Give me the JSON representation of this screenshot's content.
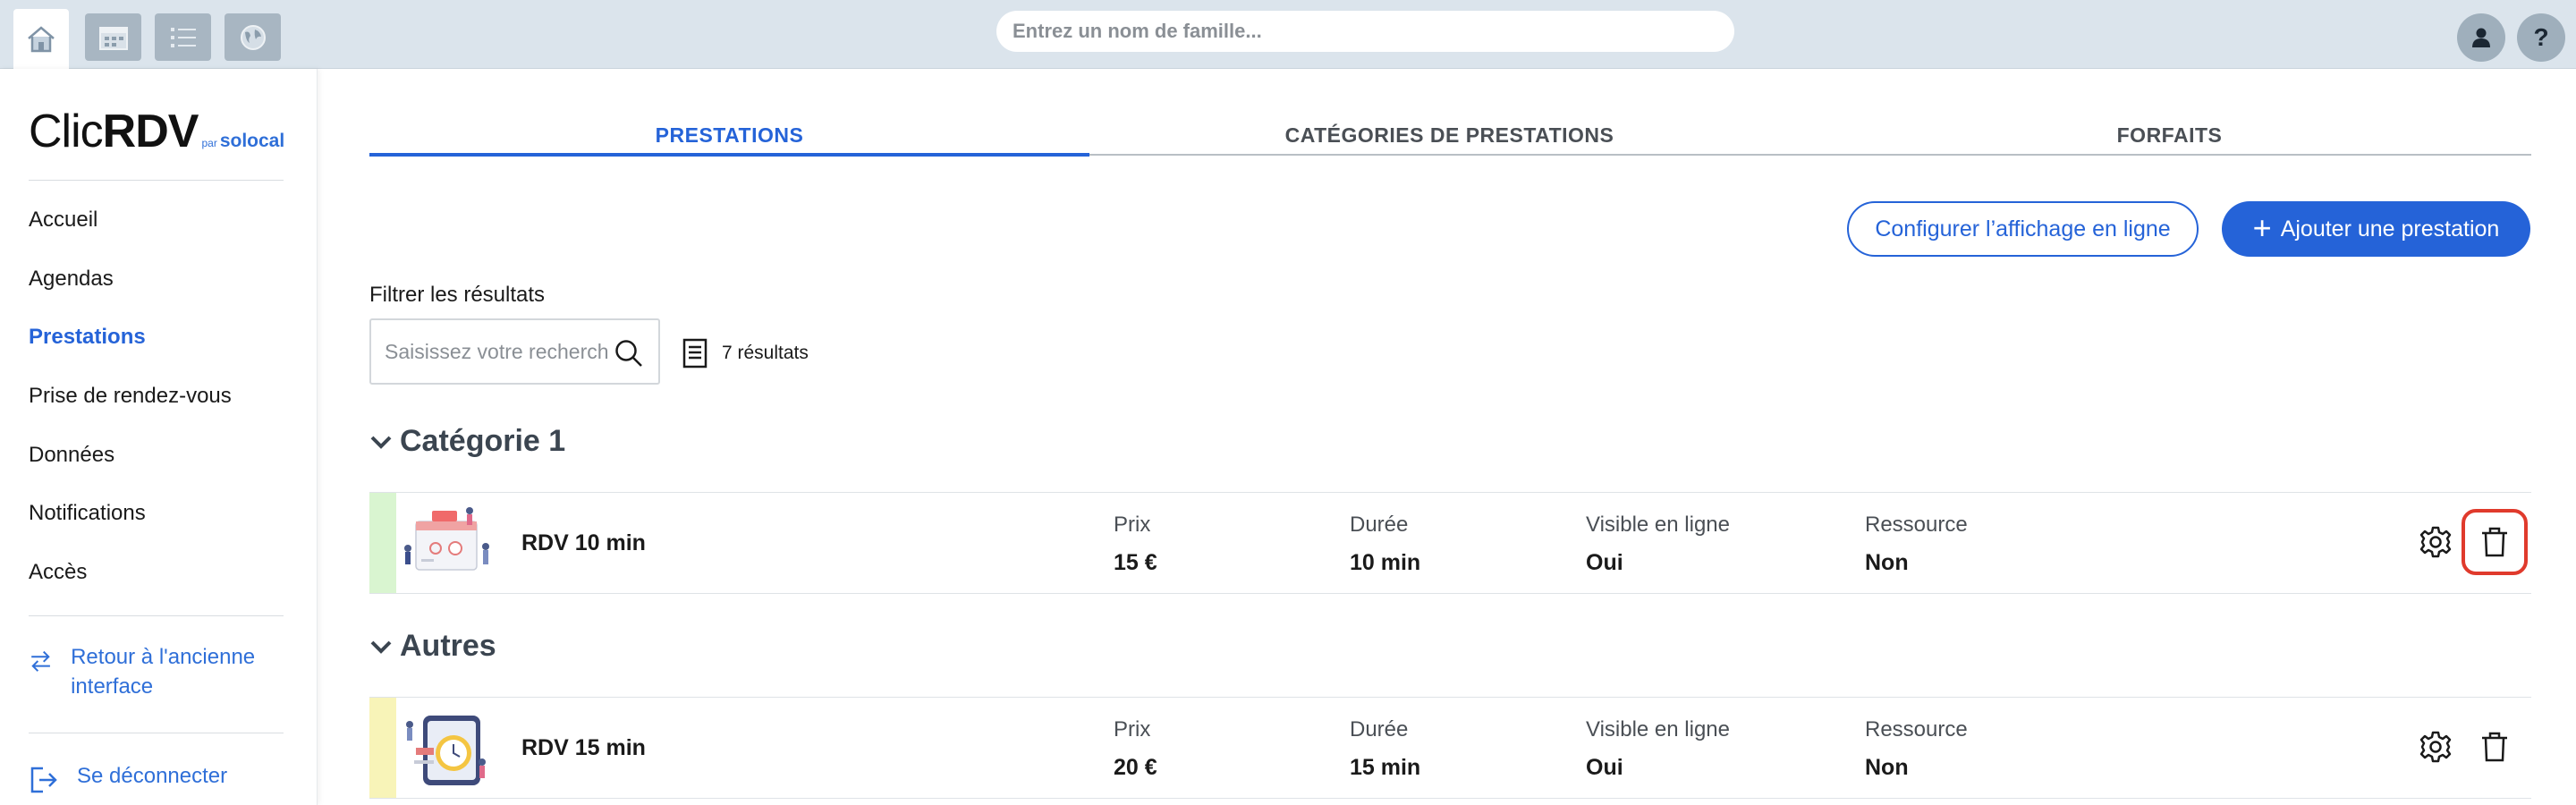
{
  "topbar": {
    "search_placeholder": "Entrez un nom de famille...",
    "help_label": "?"
  },
  "sidebar": {
    "logo": {
      "clic": "Clic",
      "rdv": "RDV",
      "by": "par",
      "brand": "solocal"
    },
    "items": [
      {
        "label": "Accueil",
        "active": false
      },
      {
        "label": "Agendas",
        "active": false
      },
      {
        "label": "Prestations",
        "active": true
      },
      {
        "label": "Prise de rendez-vous",
        "active": false
      },
      {
        "label": "Données",
        "active": false
      },
      {
        "label": "Notifications",
        "active": false
      },
      {
        "label": "Accès",
        "active": false
      }
    ],
    "legacy_link": "Retour à l'ancienne interface",
    "logout_link": "Se déconnecter"
  },
  "tabs": [
    {
      "label": "PRESTATIONS",
      "active": true
    },
    {
      "label": "CATÉGORIES DE PRESTATIONS",
      "active": false
    },
    {
      "label": "FORFAITS",
      "active": false
    }
  ],
  "actions": {
    "configure_label": "Configurer l’affichage en ligne",
    "add_label": "Ajouter une prestation",
    "add_icon": "+"
  },
  "filter": {
    "label": "Filtrer les résultats",
    "placeholder": "Saisissez votre recherche",
    "results": "7 résultats"
  },
  "categories": [
    {
      "title": "Catégorie 1",
      "rows": [
        {
          "name": "RDV 10 min",
          "stripe_color": "#d9f5d0",
          "prix_label": "Prix",
          "prix": "15 €",
          "duree_label": "Durée",
          "duree": "10 min",
          "visible_label": "Visible en ligne",
          "visible": "Oui",
          "ressource_label": "Ressource",
          "ressource": "Non"
        }
      ]
    },
    {
      "title": "Autres",
      "rows": [
        {
          "name": "RDV 15 min",
          "stripe_color": "#f8f4b8",
          "prix_label": "Prix",
          "prix": "20 €",
          "duree_label": "Durée",
          "duree": "15 min",
          "visible_label": "Visible en ligne",
          "visible": "Oui",
          "ressource_label": "Ressource",
          "ressource": "Non"
        }
      ]
    }
  ],
  "colors": {
    "accent": "#2563d8",
    "highlight": "#e03a2c"
  }
}
